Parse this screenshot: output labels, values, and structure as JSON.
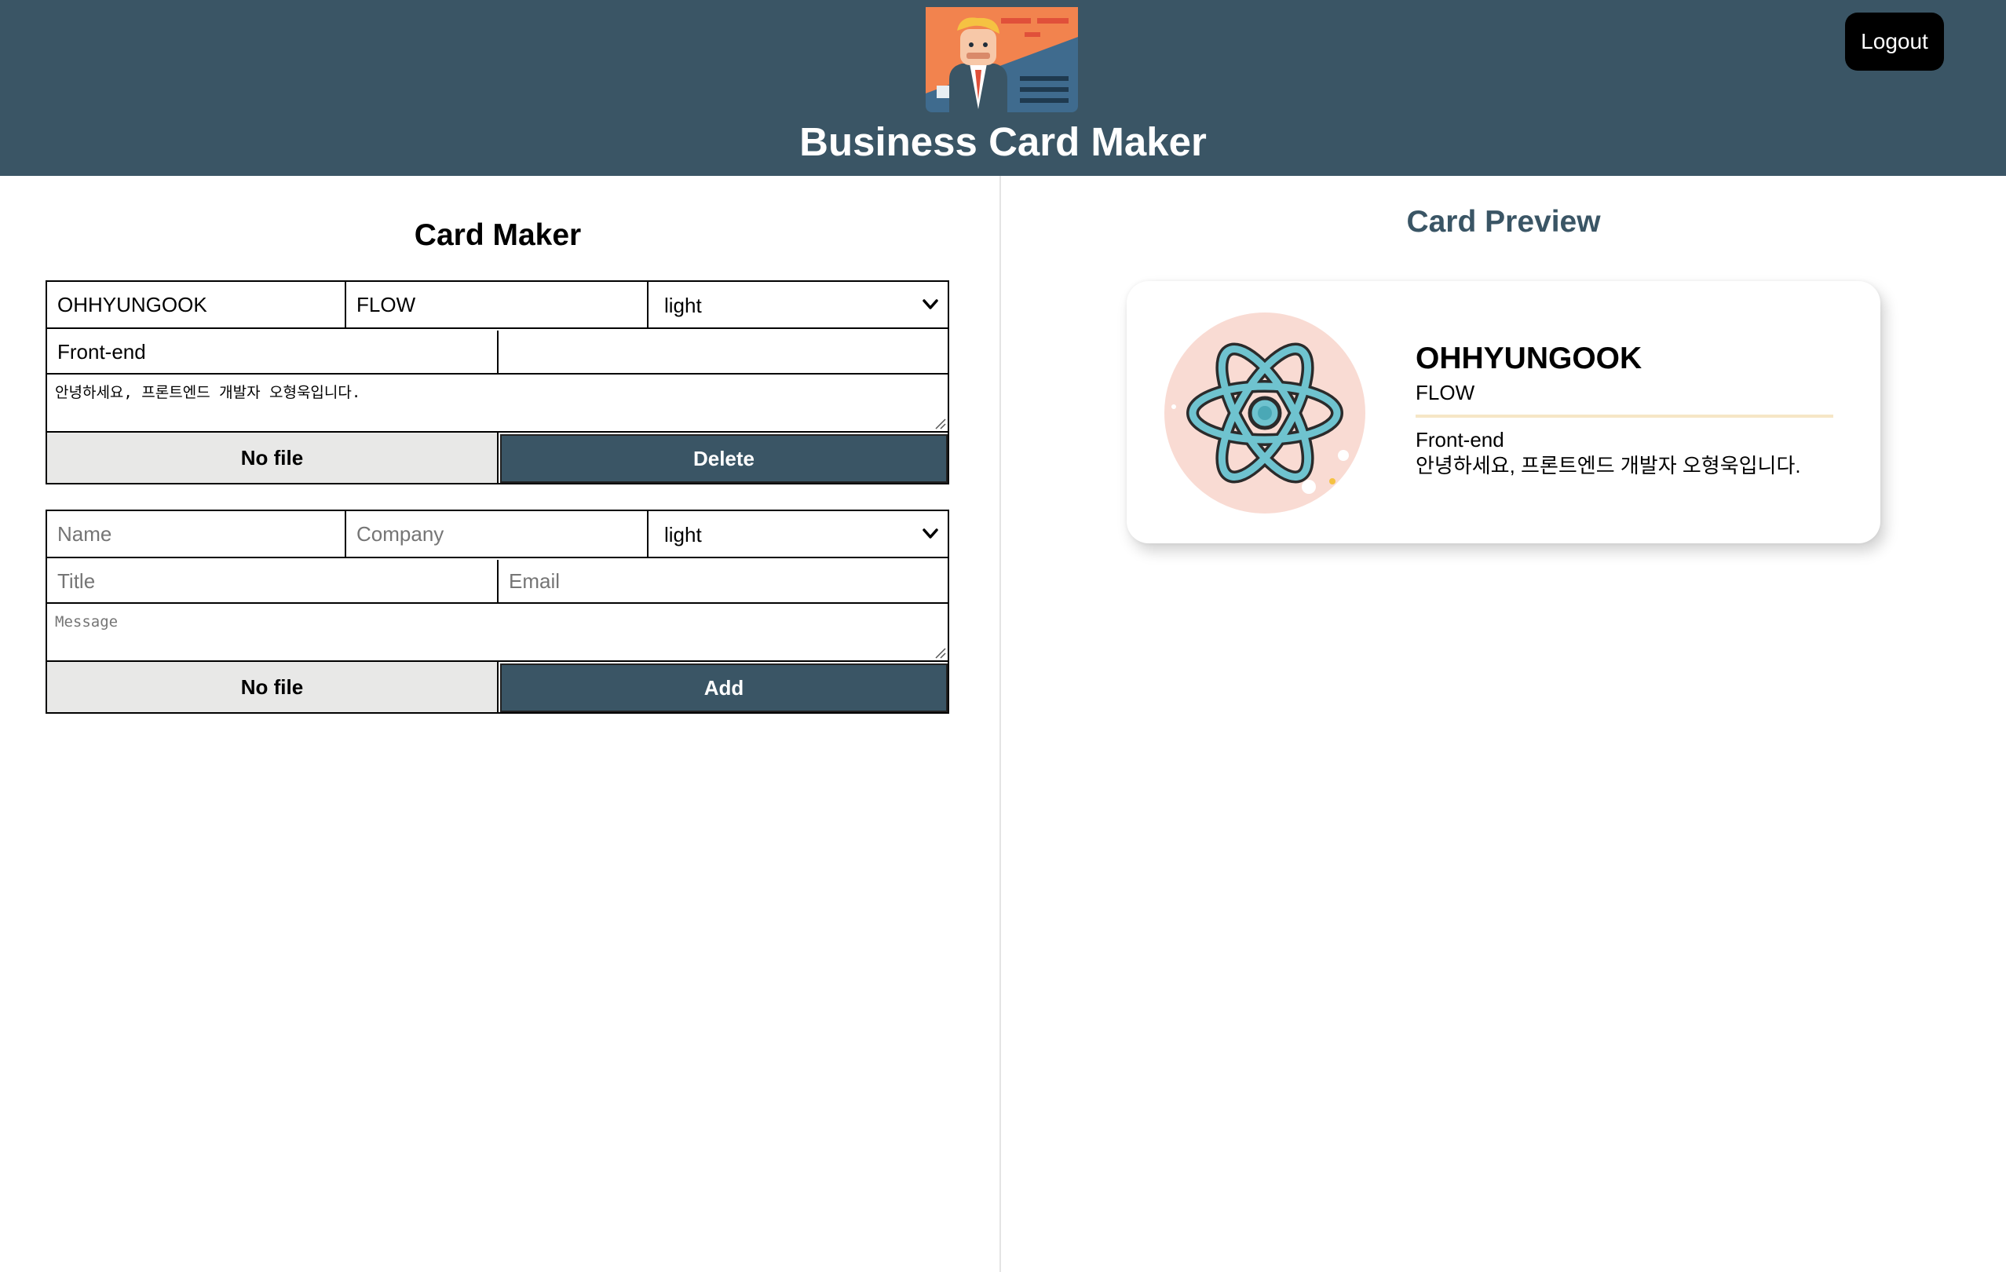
{
  "header": {
    "app_title": "Business Card Maker",
    "logout_label": "Logout",
    "logo_icon": "business-card-logo-icon"
  },
  "maker": {
    "title": "Card Maker",
    "cards": [
      {
        "name": "OHHYUNGOOK",
        "company": "FLOW",
        "theme": "light",
        "title": "Front-end",
        "email": "",
        "message": "안녕하세요, 프론트엔드 개발자 오형욱입니다.",
        "file_label": "No file",
        "action_label": "Delete"
      }
    ],
    "add_form": {
      "name_placeholder": "Name",
      "company_placeholder": "Company",
      "theme": "light",
      "title_placeholder": "Title",
      "email_placeholder": "Email",
      "message_placeholder": "Message",
      "file_label": "No file",
      "action_label": "Add"
    },
    "theme_options": [
      "light"
    ]
  },
  "preview": {
    "title": "Card Preview",
    "card": {
      "name": "OHHYUNGOOK",
      "company": "FLOW",
      "title": "Front-end",
      "message": "안녕하세요, 프론트엔드 개발자 오형욱입니다.",
      "avatar_icon": "react-atom-icon"
    }
  },
  "colors": {
    "header_bg": "#3a5565",
    "accent": "#3a5565",
    "card_rule": "#f6e6c6"
  }
}
